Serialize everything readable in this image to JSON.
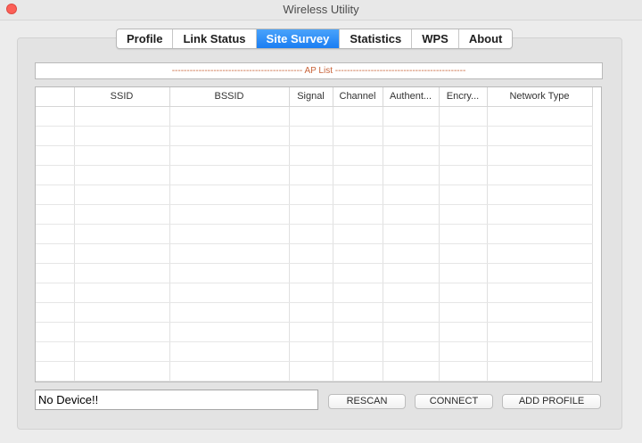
{
  "window": {
    "title": "Wireless Utility"
  },
  "tabs": [
    {
      "label": "Profile"
    },
    {
      "label": "Link Status"
    },
    {
      "label": "Site Survey"
    },
    {
      "label": "Statistics"
    },
    {
      "label": "WPS"
    },
    {
      "label": "About"
    }
  ],
  "active_tab": "Site Survey",
  "ap_list": {
    "title": "-------------------------------------------- AP List --------------------------------------------"
  },
  "table": {
    "columns": [
      "",
      "SSID",
      "BSSID",
      "Signal",
      "Channel",
      "Authent...",
      "Encry...",
      "Network Type"
    ],
    "rows": []
  },
  "status": {
    "text": "No Device!!"
  },
  "buttons": {
    "rescan": "RESCAN",
    "connect": "CONNECT",
    "add_profile": "ADD PROFILE"
  },
  "colors": {
    "accent": "#1a7df2",
    "ap_list_text": "#c8643a",
    "close": "#fc5f57"
  }
}
